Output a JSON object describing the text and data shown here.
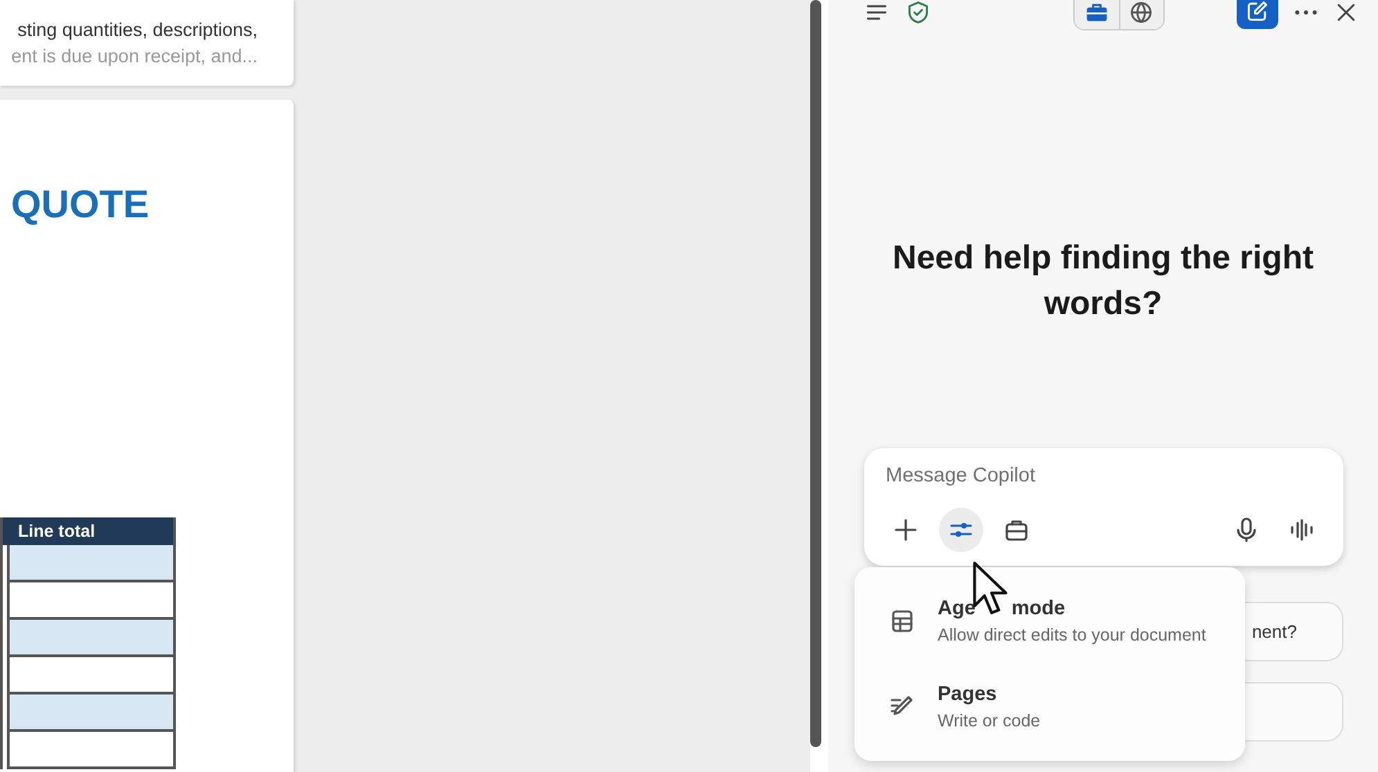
{
  "document": {
    "snippet_lines": [
      "sting quantities, descriptions,",
      "ent is due upon receipt, and..."
    ],
    "title": "QUOTE",
    "table": {
      "header": "Line total",
      "rows": [
        {
          "shaded": true
        },
        {
          "shaded": false
        },
        {
          "shaded": true
        },
        {
          "shaded": false
        },
        {
          "shaded": true
        },
        {
          "shaded": false
        }
      ]
    }
  },
  "copilot": {
    "toolbar": [
      {
        "kind": "menu"
      },
      {
        "kind": "shield"
      },
      {
        "kind": "work",
        "selected": true
      },
      {
        "kind": "web",
        "selected": false
      },
      {
        "kind": "compose"
      },
      {
        "kind": "more"
      },
      {
        "kind": "close"
      }
    ],
    "heading": "Need help finding the right words?",
    "composer": {
      "placeholder": "Message Copilot",
      "tools": [
        {
          "kind": "add",
          "selected": false
        },
        {
          "kind": "settings",
          "selected": true
        },
        {
          "kind": "briefcase",
          "selected": false
        },
        {
          "kind": "mic",
          "selected": false
        },
        {
          "kind": "voice",
          "selected": false
        }
      ]
    },
    "suggestions": [
      {
        "kind": "text",
        "text": "nent?"
      },
      {
        "kind": "covered"
      }
    ],
    "menu": [
      {
        "kind": "agent",
        "title_parts": [
          "Age",
          "mode"
        ],
        "subtitle": "Allow direct edits to your document"
      },
      {
        "kind": "pages",
        "title_parts": [
          "Pages"
        ],
        "subtitle": "Write or code"
      }
    ]
  }
}
